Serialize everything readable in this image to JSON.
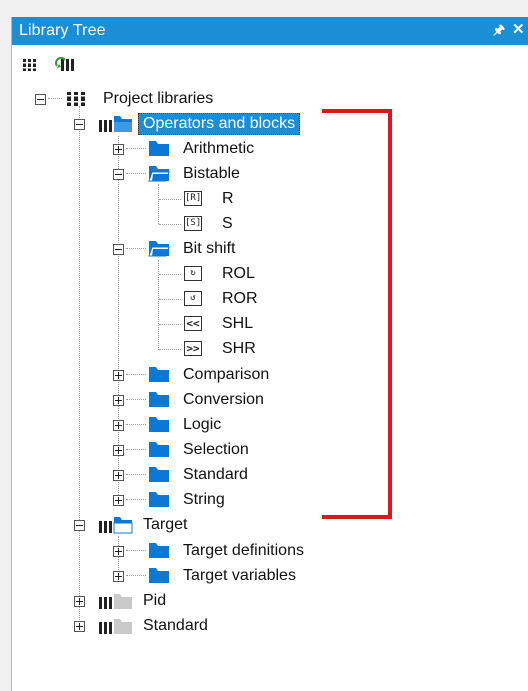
{
  "window": {
    "title": "Library Tree",
    "pin_glyph": "❘",
    "close_glyph": "✕"
  },
  "toolbar": {
    "buttons": [
      "library-icon",
      "refresh-library-icon"
    ]
  },
  "tree": {
    "root": "Project libraries",
    "operators": {
      "label": "Operators and blocks",
      "arithmetic": "Arithmetic",
      "bistable": "Bistable",
      "bistable_items": [
        "R",
        "S"
      ],
      "bistable_icons": [
        "[R]",
        "[S]"
      ],
      "bitshift": "Bit shift",
      "bitshift_items": [
        "ROL",
        "ROR",
        "SHL",
        "SHR"
      ],
      "bitshift_icons": [
        "↻",
        "↺",
        "<<",
        ">>"
      ],
      "comparison": "Comparison",
      "conversion": "Conversion",
      "logic": "Logic",
      "selection": "Selection",
      "standard": "Standard",
      "string": "String"
    },
    "target": {
      "label": "Target",
      "definitions": "Target definitions",
      "variables": "Target variables"
    },
    "pid": "Pid",
    "standard": "Standard"
  },
  "colors": {
    "accent": "#1a8fd6",
    "folder": "#0a78d7",
    "bracket": "#e0141e"
  }
}
